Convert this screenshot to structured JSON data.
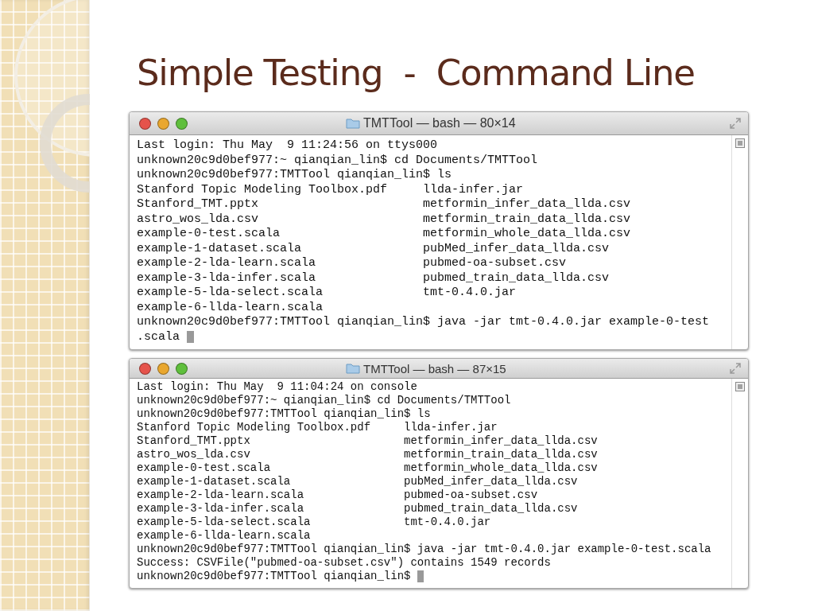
{
  "slide": {
    "title": "Simple Testing  -  Command Line"
  },
  "terminals": [
    {
      "title": "TMTTool — bash — 80×14",
      "lines": [
        {
          "kind": "text",
          "text": "Last login: Thu May  9 11:24:56 on ttys000"
        },
        {
          "kind": "text",
          "text": "unknown20c9d0bef977:~ qianqian_lin$ cd Documents/TMTTool"
        },
        {
          "kind": "text",
          "text": "unknown20c9d0bef977:TMTTool qianqian_lin$ ls"
        },
        {
          "kind": "columns",
          "cells": [
            "Stanford Topic Modeling Toolbox.pdf",
            "llda-infer.jar"
          ]
        },
        {
          "kind": "columns",
          "cells": [
            "Stanford_TMT.pptx",
            "metformin_infer_data_llda.csv"
          ]
        },
        {
          "kind": "columns",
          "cells": [
            "astro_wos_lda.csv",
            "metformin_train_data_llda.csv"
          ]
        },
        {
          "kind": "columns",
          "cells": [
            "example-0-test.scala",
            "metformin_whole_data_llda.csv"
          ]
        },
        {
          "kind": "columns",
          "cells": [
            "example-1-dataset.scala",
            "pubMed_infer_data_llda.csv"
          ]
        },
        {
          "kind": "columns",
          "cells": [
            "example-2-lda-learn.scala",
            "pubmed-oa-subset.csv"
          ]
        },
        {
          "kind": "columns",
          "cells": [
            "example-3-lda-infer.scala",
            "pubmed_train_data_llda.csv"
          ]
        },
        {
          "kind": "columns",
          "cells": [
            "example-5-lda-select.scala",
            "tmt-0.4.0.jar"
          ]
        },
        {
          "kind": "text",
          "text": "example-6-llda-learn.scala"
        },
        {
          "kind": "text",
          "text": "unknown20c9d0bef977:TMTTool qianqian_lin$ java -jar tmt-0.4.0.jar example-0-test"
        },
        {
          "kind": "text",
          "text": ".scala",
          "cursor": true
        }
      ]
    },
    {
      "title": "TMTTool — bash — 87×15",
      "lines": [
        {
          "kind": "text",
          "text": "Last login: Thu May  9 11:04:24 on console"
        },
        {
          "kind": "text",
          "text": "unknown20c9d0bef977:~ qianqian_lin$ cd Documents/TMTTool"
        },
        {
          "kind": "text",
          "text": "unknown20c9d0bef977:TMTTool qianqian_lin$ ls"
        },
        {
          "kind": "columns",
          "cells": [
            "Stanford Topic Modeling Toolbox.pdf",
            "llda-infer.jar"
          ]
        },
        {
          "kind": "columns",
          "cells": [
            "Stanford_TMT.pptx",
            "metformin_infer_data_llda.csv"
          ]
        },
        {
          "kind": "columns",
          "cells": [
            "astro_wos_lda.csv",
            "metformin_train_data_llda.csv"
          ]
        },
        {
          "kind": "columns",
          "cells": [
            "example-0-test.scala",
            "metformin_whole_data_llda.csv"
          ]
        },
        {
          "kind": "columns",
          "cells": [
            "example-1-dataset.scala",
            "pubMed_infer_data_llda.csv"
          ]
        },
        {
          "kind": "columns",
          "cells": [
            "example-2-lda-learn.scala",
            "pubmed-oa-subset.csv"
          ]
        },
        {
          "kind": "columns",
          "cells": [
            "example-3-lda-infer.scala",
            "pubmed_train_data_llda.csv"
          ]
        },
        {
          "kind": "columns",
          "cells": [
            "example-5-lda-select.scala",
            "tmt-0.4.0.jar"
          ]
        },
        {
          "kind": "text",
          "text": "example-6-llda-learn.scala"
        },
        {
          "kind": "text",
          "text": "unknown20c9d0bef977:TMTTool qianqian_lin$ java -jar tmt-0.4.0.jar example-0-test.scala"
        },
        {
          "kind": "text",
          "text": "Success: CSVFile(\"pubmed-oa-subset.csv\") contains 1549 records"
        },
        {
          "kind": "text",
          "text": "unknown20c9d0bef977:TMTTool qianqian_lin$",
          "cursor": true
        }
      ]
    }
  ]
}
